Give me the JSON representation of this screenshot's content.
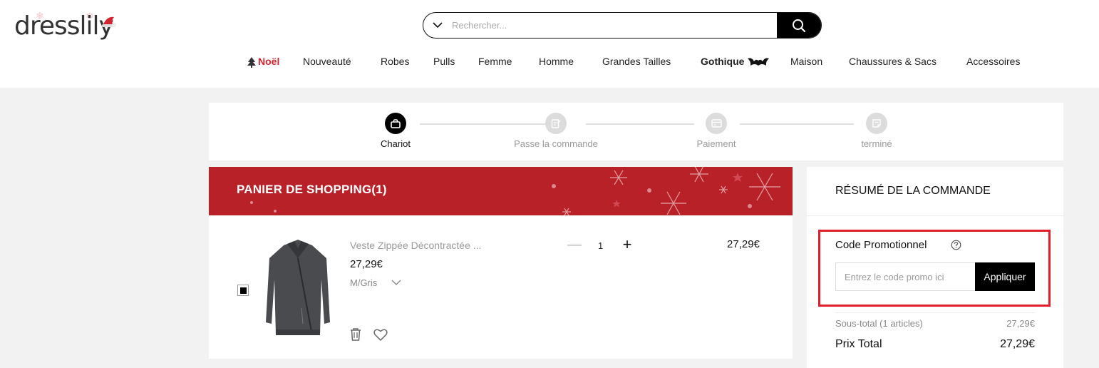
{
  "brand": {
    "logo_text": "dresslily"
  },
  "search": {
    "placeholder": "Rechercher..."
  },
  "nav": {
    "items": [
      "Noël",
      "Nouveauté",
      "Robes",
      "Pulls",
      "Femme",
      "Homme",
      "Grandes Tailles",
      "Gothique",
      "Maison",
      "Chaussures & Sacs",
      "Accessoires"
    ]
  },
  "steps": {
    "items": [
      "Chariot",
      "Passe la commande",
      "Paiement",
      "terminé"
    ],
    "active_index": 0
  },
  "cart": {
    "title": "PANIER DE SHOPPING(1)",
    "item": {
      "name": "Veste Zippée Décontractée ...",
      "price": "27,29€",
      "variant": "M/Gris",
      "quantity": "1",
      "total": "27,29€"
    }
  },
  "summary": {
    "title": "RÉSUMÉ DE LA COMMANDE",
    "promo_label": "Code Promotionnel",
    "promo_placeholder": "Entrez le code promo ici",
    "apply_label": "Appliquer",
    "subtotal_label": "Sous-total (1 articles)",
    "subtotal_value": "27,29€",
    "total_label": "Prix Total",
    "total_value": "27,29€"
  },
  "colors": {
    "brand_red": "#b92128",
    "highlight_red": "#e01e2b",
    "noel_red": "#d4242e",
    "black": "#000000"
  },
  "icons": [
    "search-icon",
    "chevron-down-icon",
    "cart-icon",
    "order-icon",
    "payment-icon",
    "done-icon",
    "trash-icon",
    "heart-icon",
    "help-icon",
    "tree-icon",
    "bat-icon",
    "santa-hat-icon"
  ]
}
